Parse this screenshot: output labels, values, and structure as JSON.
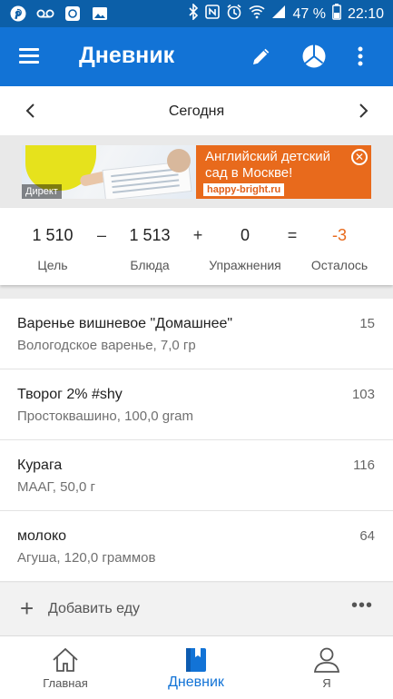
{
  "statusbar": {
    "battery_percent": "47 %",
    "time": "22:10",
    "left_icons": [
      "pinterest-icon",
      "voicemail-icon",
      "app-notification-icon",
      "image-icon"
    ],
    "right_icons": [
      "bluetooth-icon",
      "nfc-icon",
      "alarm-icon",
      "wifi-icon",
      "signal-icon",
      "battery-icon"
    ]
  },
  "appbar": {
    "title": "Дневник",
    "color": "#1273d6",
    "actions": [
      "pencil-icon",
      "pie-chart-icon",
      "more-vert-icon"
    ]
  },
  "datebar": {
    "label": "Сегодня"
  },
  "ad": {
    "badge": "Директ",
    "text": "Английский детский сад в Москве!",
    "url": "happy-bright.ru",
    "color": "#e86a1c"
  },
  "summary": {
    "goal_value": "1 510",
    "goal_label": "Цель",
    "op_minus": "–",
    "food_value": "1 513",
    "food_label": "Блюда",
    "op_plus": "+",
    "exercise_value": "0",
    "exercise_label": "Упражнения",
    "op_equals": "=",
    "remaining_value": "-3",
    "remaining_label": "Осталось",
    "remaining_color": "#e86a1c"
  },
  "foods": [
    {
      "name": "Варенье вишневое \"Домашнее\"",
      "detail": "Вологодское варенье, 7,0 гр",
      "calories": "15"
    },
    {
      "name": "Творог 2% #shy",
      "detail": "Простоквашино, 100,0 gram",
      "calories": "103"
    },
    {
      "name": "Курага",
      "detail": "МААГ, 50,0 г",
      "calories": "116"
    },
    {
      "name": "молоко",
      "detail": "Агуша, 120,0 граммов",
      "calories": "64"
    }
  ],
  "add_food": {
    "label": "Добавить еду"
  },
  "bottom_nav": [
    {
      "label": "Главная",
      "icon": "home-icon"
    },
    {
      "label": "Дневник",
      "icon": "diary-icon",
      "active": true
    },
    {
      "label": "Я",
      "icon": "person-icon"
    }
  ]
}
